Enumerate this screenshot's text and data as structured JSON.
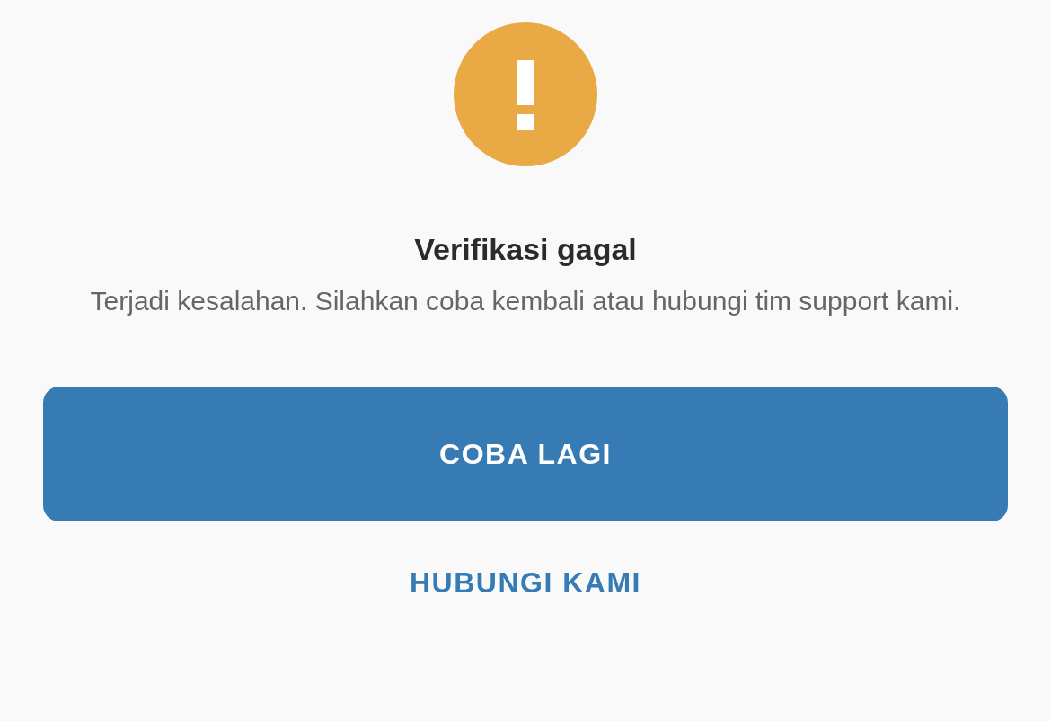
{
  "dialog": {
    "title": "Verifikasi gagal",
    "message": "Terjadi kesalahan. Silahkan coba kembali atau hubungi tim support kami.",
    "primary_button": "COBA LAGI",
    "secondary_link": "HUBUNGI KAMI"
  }
}
